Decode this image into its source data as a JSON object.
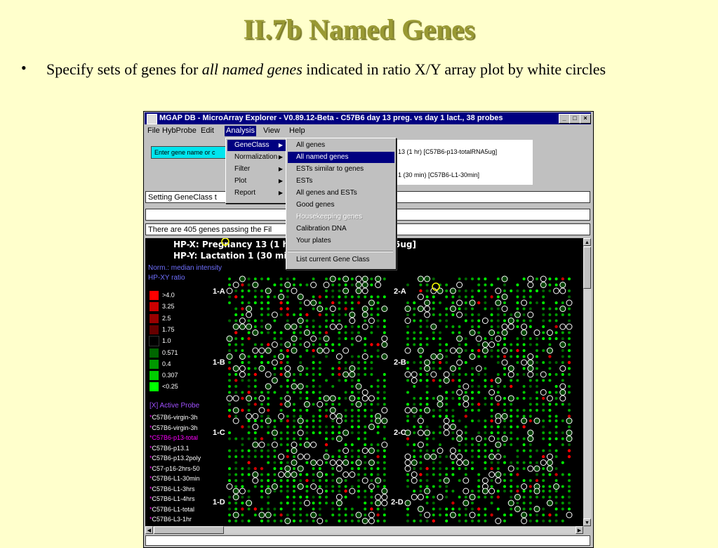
{
  "slide": {
    "title": "II.7b Named Genes",
    "bullet": "•",
    "bullet_pre": "Specify sets of  genes for ",
    "bullet_em": "all named genes",
    "bullet_post": " indicated in ratio X/Y array plot by white circles"
  },
  "window": {
    "title": "MGAP DB - MicroArray Explorer - V0.89.12-Beta - C57B6 day 13 preg. vs day 1 lact., 38 probes",
    "buttons": {
      "minimize": "_",
      "maximize": "□",
      "close": "×"
    }
  },
  "menubar": [
    "File",
    "HybProbe",
    "Edit",
    "Analysis",
    "View",
    "Help"
  ],
  "toolbar": {
    "gene_button": "Enter gene name or c",
    "info_x": "13  (1 hr) [C57B6-p13-totalRNA5ug]",
    "info_y": "1  (30 min) [C57B6-L1-30min]"
  },
  "fields": {
    "status1": "Setting GeneClass t",
    "status2": "",
    "status3": "There are 405 genes passing the Fil"
  },
  "analysis_menu": [
    "GeneClass",
    "Normalization",
    "Filter",
    "Plot",
    "Report"
  ],
  "arrow_glyph": "▶",
  "geneclass_menu": [
    "All genes",
    "All named genes",
    "ESTs similar to genes",
    "ESTs",
    "All genes and ESTs",
    "Good genes",
    "Housekeeping genes",
    "Calibration DNA",
    "Your plates"
  ],
  "geneclass_menu_last": "List current Gene Class",
  "plot": {
    "hp_x": "HP-X: Pregnancy 13  (1 h",
    "hp_x_tail": "5ug]",
    "hp_y": "HP-Y: Lactation 1  (30 mi",
    "norm": "Norm.: median intensity",
    "ratio": "HP-XY ratio",
    "legend": [
      {
        "label": ">4.0",
        "color": "#ff0000"
      },
      {
        "label": "3.25",
        "color": "#cc0000"
      },
      {
        "label": "2.5",
        "color": "#990000"
      },
      {
        "label": "1.75",
        "color": "#660000"
      },
      {
        "label": "1.0",
        "color": "#000000"
      },
      {
        "label": "0.571",
        "color": "#006600"
      },
      {
        "label": "0.4",
        "color": "#009900"
      },
      {
        "label": "0.307",
        "color": "#00cc00"
      },
      {
        "label": "<0.25",
        "color": "#00ff00"
      }
    ],
    "active_probe": "[X] Active Probe",
    "probes": [
      "C57B6-virgin-3h",
      "C57B6-virgin-3h",
      "C57B6-p13-total",
      "C57B6-p13.1",
      "C57B6-p13.2poly",
      "C57-p16-2hrs-50",
      "C57B6-L1-30min",
      "C57B6-L1-3hrs",
      "C57B6-L1-4hrs",
      "C57B6-L1-total",
      "C57B6-L3-1hr"
    ],
    "probe_dot": "*",
    "sections": [
      "1-A",
      "2-A",
      "1-B",
      "2-B",
      "1-C",
      "2-C",
      "1-D",
      "2-D"
    ]
  },
  "scroll": {
    "up": "▲",
    "down": "▼",
    "left": "◀",
    "right": "▶"
  }
}
